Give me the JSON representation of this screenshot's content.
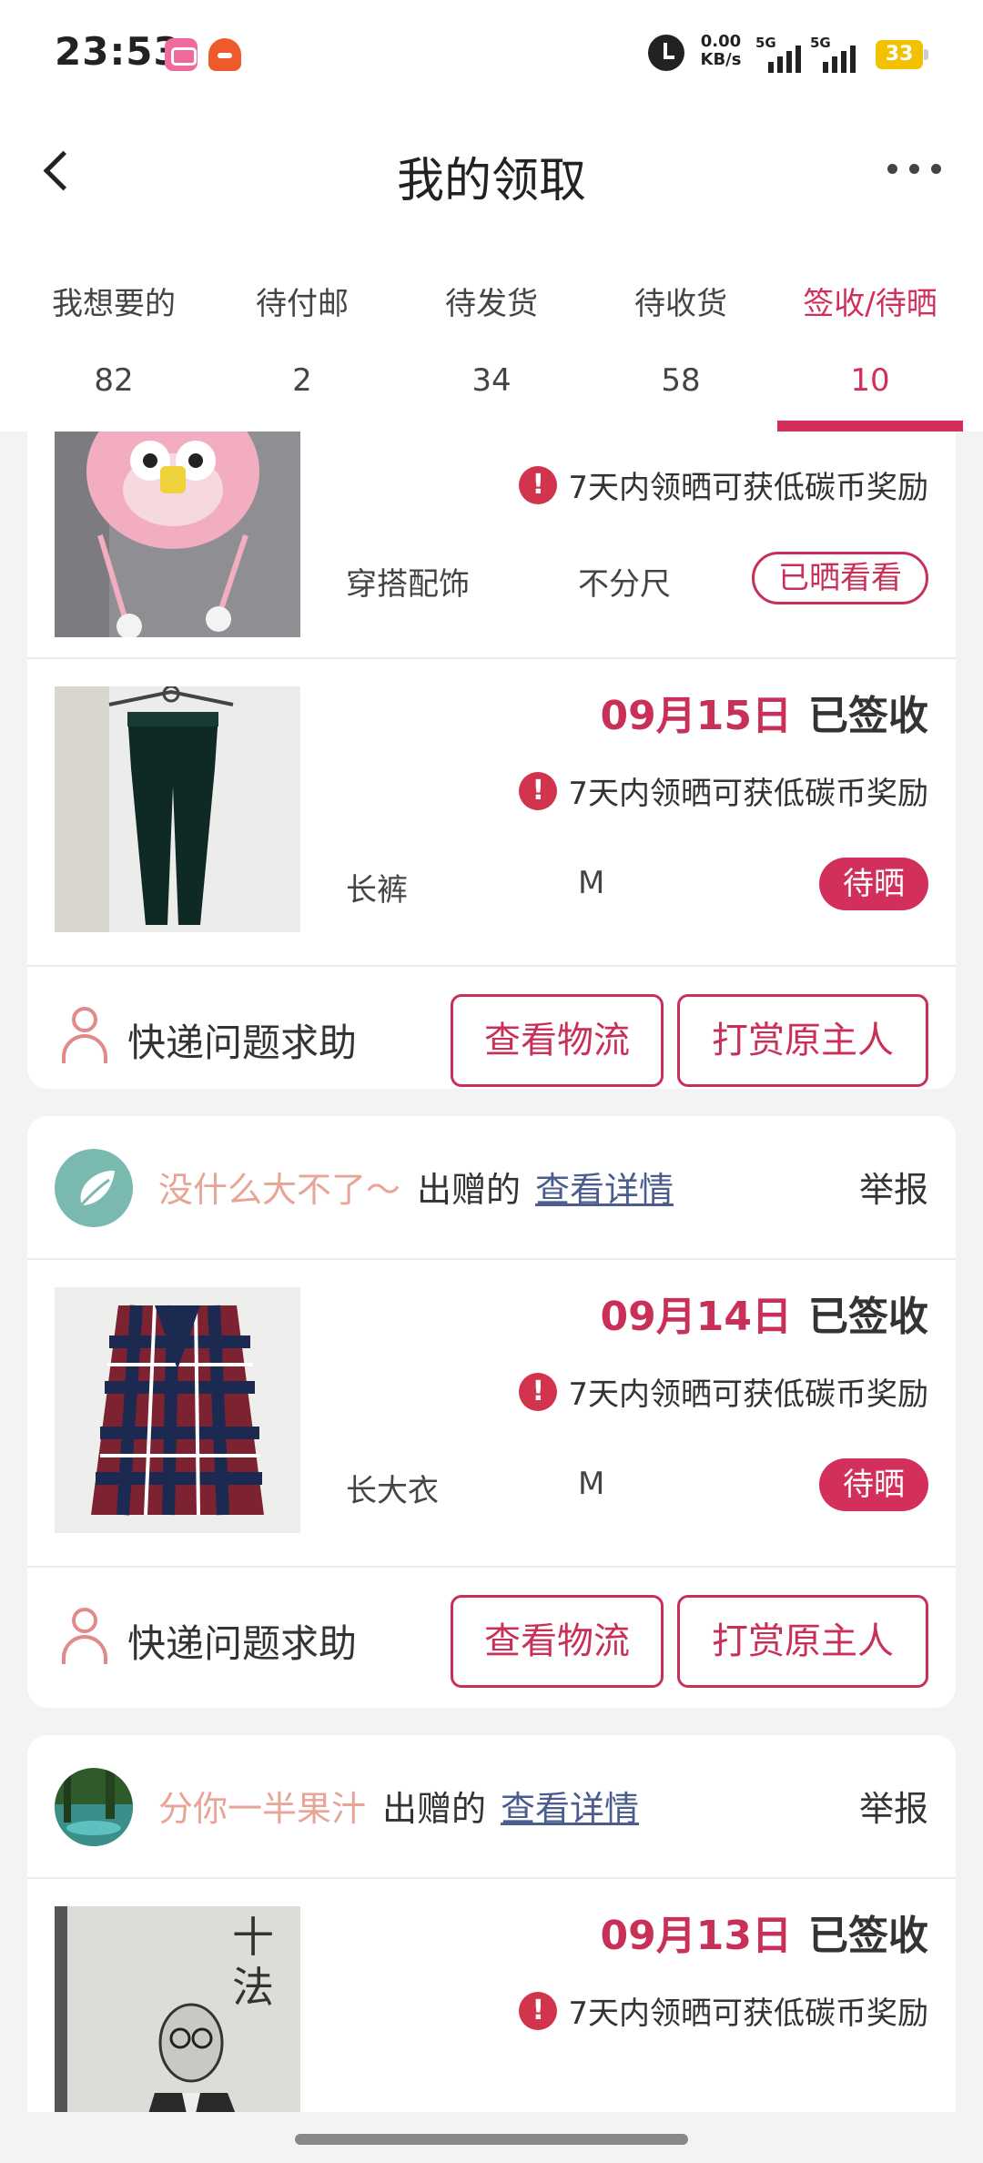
{
  "status_bar": {
    "time": "23:53",
    "net_speed": "0.00",
    "net_unit": "KB/s",
    "sig1": "5G",
    "sig2": "5G",
    "battery": "33"
  },
  "header": {
    "title": "我的领取"
  },
  "tabs": [
    {
      "label": "我想要的",
      "count": "82"
    },
    {
      "label": "待付邮",
      "count": "2"
    },
    {
      "label": "待发货",
      "count": "34"
    },
    {
      "label": "待收货",
      "count": "58"
    },
    {
      "label": "签收/待晒",
      "count": "10"
    }
  ],
  "accent_color": "#d32f5b",
  "reward_text": "7天内领晒可获低碳币奖励",
  "signed_label": "已签收",
  "help_label": "快递问题求助",
  "logistics_btn": "查看物流",
  "tip_btn": "打赏原主人",
  "gave_label": "出赠的",
  "detail_link": "查看详情",
  "report_label": "举报",
  "items": [
    {
      "category": "穿搭配饰",
      "size": "不分尺",
      "status": "已晒看看"
    },
    {
      "date": "09月15日",
      "category": "长裤",
      "size": "M",
      "status": "待晒"
    },
    {
      "giver": "没什么大不了～",
      "date": "09月14日",
      "category": "长大衣",
      "size": "M",
      "status": "待晒"
    },
    {
      "giver": "分你一半果汁",
      "date": "09月13日"
    }
  ]
}
